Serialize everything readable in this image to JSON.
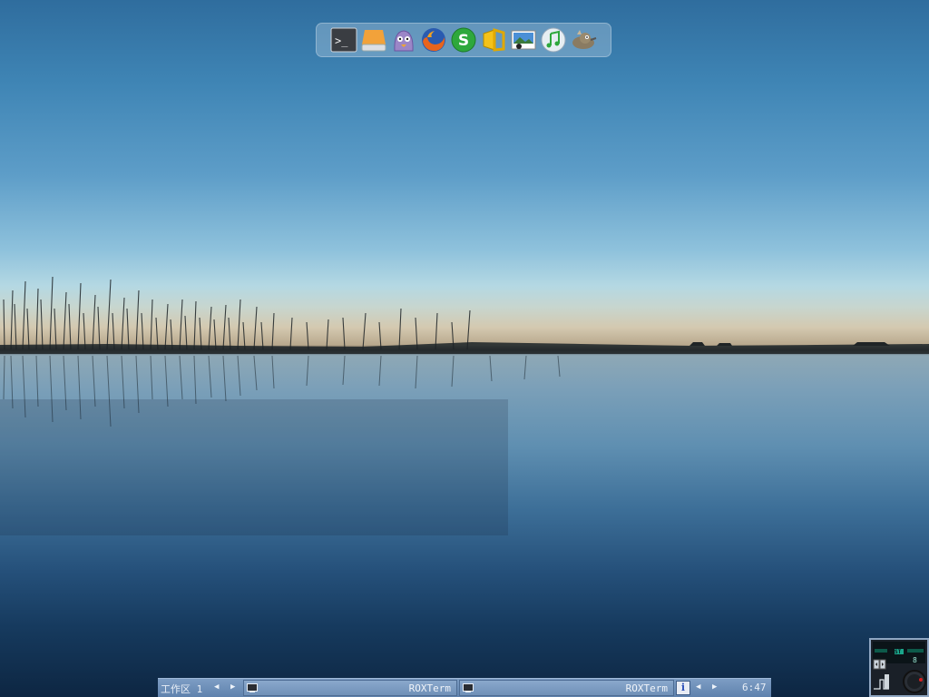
{
  "dock": {
    "icons": [
      "terminal-icon",
      "file-manager-icon",
      "pidgin-icon",
      "firefox-icon",
      "skype-icon",
      "office-icon",
      "image-viewer-icon",
      "music-player-icon",
      "gimp-icon"
    ]
  },
  "taskbar": {
    "workspace_label": "工作区 1",
    "tasks": [
      {
        "label": "ROXTerm"
      },
      {
        "label": "ROXTerm"
      }
    ],
    "info_label": "i",
    "clock": "6:47"
  },
  "dockapp": {
    "badge": "ST",
    "readout": "8"
  }
}
